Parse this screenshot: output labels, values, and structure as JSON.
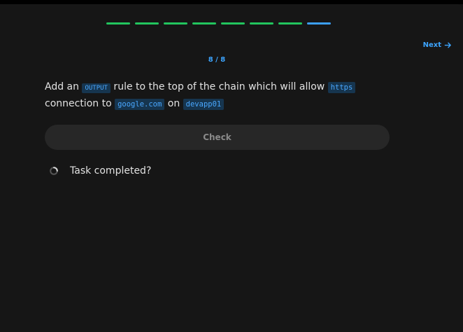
{
  "progress": {
    "total": 8,
    "current": 8
  },
  "nav": {
    "next_label": "Next"
  },
  "counter": "8 / 8",
  "task": {
    "part1": "Add an ",
    "code1": "OUTPUT",
    "part2": " rule to the top of the chain which will allow ",
    "code2": "https",
    "part3": " connection to ",
    "code3": "google.com",
    "part4": " on ",
    "code4": "devapp01"
  },
  "check_button": {
    "label": "Check"
  },
  "status": {
    "label": "Task completed?"
  },
  "colors": {
    "done": "#22c55e",
    "current": "#3b9ef5",
    "accent": "#3da5ff",
    "code_bg": "#16354f"
  },
  "icons": {
    "next": "arrow-right-icon",
    "status": "loading-spinner-icon"
  }
}
